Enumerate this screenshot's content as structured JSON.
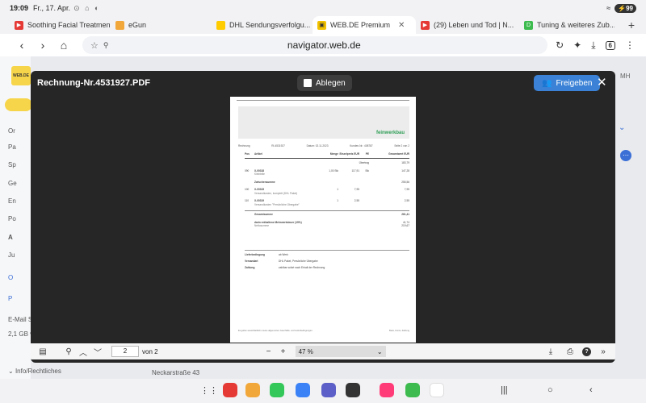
{
  "status": {
    "time": "19:09",
    "date": "Fr., 17. Apr.",
    "battery": "99"
  },
  "tabs": [
    {
      "label": "Soothing Facial Treatmen...",
      "icon_color": "#e53935",
      "icon": "youtube-icon"
    },
    {
      "label": "eGun",
      "icon_color": "#f2a73b",
      "icon": "egun-icon"
    },
    {
      "label": "DHL Sendungsverfolgu...",
      "icon_color": "#ffcc00",
      "icon": "dhl-icon"
    },
    {
      "label": "WEB.DE Premium",
      "icon_color": "#f2c200",
      "icon": "webde-icon",
      "active": true
    },
    {
      "label": "(29) Leben und Tod | N...",
      "icon_color": "#e53935",
      "icon": "youtube-icon"
    },
    {
      "label": "Tuning & weiteres Zub...",
      "icon_color": "#3dbb4e",
      "icon": "tuning-icon"
    }
  ],
  "address": {
    "url": "navigator.web.de",
    "tab_count": "6"
  },
  "background": {
    "sidebar_letters": [
      "Or",
      "Pa",
      "Sp",
      "Ge",
      "En",
      "Po",
      "A",
      "Ju",
      "O",
      "P",
      "E-Mail S",
      "2,1 GB v"
    ],
    "footer_left": "Info/Rechtliches",
    "footer_mid": "Neckarstraße 43",
    "user_initials": "MH",
    "logo_text": "WEB.DE"
  },
  "viewer": {
    "title": "Rechnung-Nr.4531927.PDF",
    "ablegen_label": "Ablegen",
    "freigeben_label": "Freigeben",
    "page_input": "2",
    "page_count": "von 2",
    "zoom": "47 %"
  },
  "pdf": {
    "brand": "feinwerkbau",
    "meta": [
      "Rechnung",
      "RI-4531927",
      "Datum: 02.11.2023",
      "Kunden-Nr.: 408787",
      "Seite 2 von 2"
    ],
    "headers": [
      "Pos",
      "Artikel",
      "Menge",
      "Einzelpreis EUR",
      "PE",
      "Gesamtwert EUR"
    ],
    "uebertrag_label": "Übertrag",
    "uebertrag_value": "183,79",
    "rows": [
      {
        "pos": "090",
        "code": "X-00318",
        "desc": "Kleinteile",
        "menge": "1,00 Stk",
        "preis": "117,91",
        "pe": "Stk",
        "gesamt": "147,28"
      },
      {
        "pos": "",
        "code": "Zwischensumme",
        "desc": "",
        "menge": "",
        "preis": "",
        "pe": "",
        "gesamt": "255,56"
      },
      {
        "pos": "100",
        "code": "X-00315",
        "desc": "Versandkosten, komplett (DHL Paket)",
        "menge": "1",
        "preis": "7,95",
        "pe": "",
        "gesamt": "7,95"
      },
      {
        "pos": "110",
        "code": "X-00319",
        "desc": "Versandkosten \"Persönliche Übergabe\"",
        "menge": "1",
        "preis": "2,55",
        "pe": "",
        "gesamt": "2,55"
      }
    ],
    "gesamt_label": "Gesamtsumme",
    "gesamt_value": "261,41",
    "mwst_label": "darin enthaltene Mehrwertsteuer (19%)",
    "mwst_sub": "Nettosumme",
    "mwst_value": "41,74",
    "netto_value": "219,67",
    "terms": [
      {
        "k": "Lieferbedingung",
        "v": "ab Werk"
      },
      {
        "k": "Versandart",
        "v": "DHL Paket, Persönliche Übergabe"
      },
      {
        "k": "Zahlung",
        "v": "zahlbar sofort nach Erhalt der Rechnung"
      }
    ],
    "foot_left": "Es gelten ausschließlich unsere allgemeinen Geschäfts- und Lieferbedingungen.",
    "foot_right": "Bank, Konto, Zahlung"
  },
  "dock": {
    "apps": [
      "#e53935",
      "#f2a73b",
      "#34c759",
      "#3b82f6",
      "#5b5fc7",
      "#333333",
      "#f0a",
      "#3dbb4e",
      "#ffffff"
    ]
  }
}
